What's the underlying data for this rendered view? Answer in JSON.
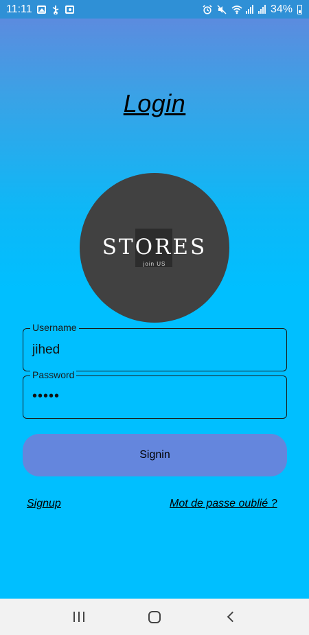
{
  "status_bar": {
    "time": "11:11",
    "battery": "34%",
    "icons_left": [
      "image-icon",
      "usb-icon",
      "camera-icon"
    ],
    "icons_right": [
      "alarm-icon",
      "mute-icon",
      "wifi-icon",
      "signal-icon",
      "signal-icon",
      "battery-icon"
    ]
  },
  "page": {
    "title": "Login",
    "logo_text": "STORES",
    "logo_subtext": "join US"
  },
  "form": {
    "username_label": "Username",
    "username_value": "jihed",
    "password_label": "Password",
    "password_value": "•••••",
    "signin_label": "Signin"
  },
  "links": {
    "signup": "Signup",
    "forgot_password": "Mot de passe oublié ?"
  },
  "colors": {
    "status_bar": "#2f90d6",
    "background": "#00bfff",
    "button": "#6486dd",
    "logo_circle": "#414141"
  }
}
